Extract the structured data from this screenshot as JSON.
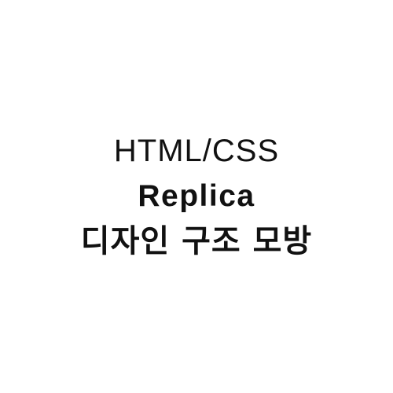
{
  "title_block": {
    "line1": "HTML/CSS",
    "line2": "Replica",
    "line3": "디자인 구조 모방"
  },
  "colors": {
    "background": "#ffffff",
    "text": "#111111"
  }
}
